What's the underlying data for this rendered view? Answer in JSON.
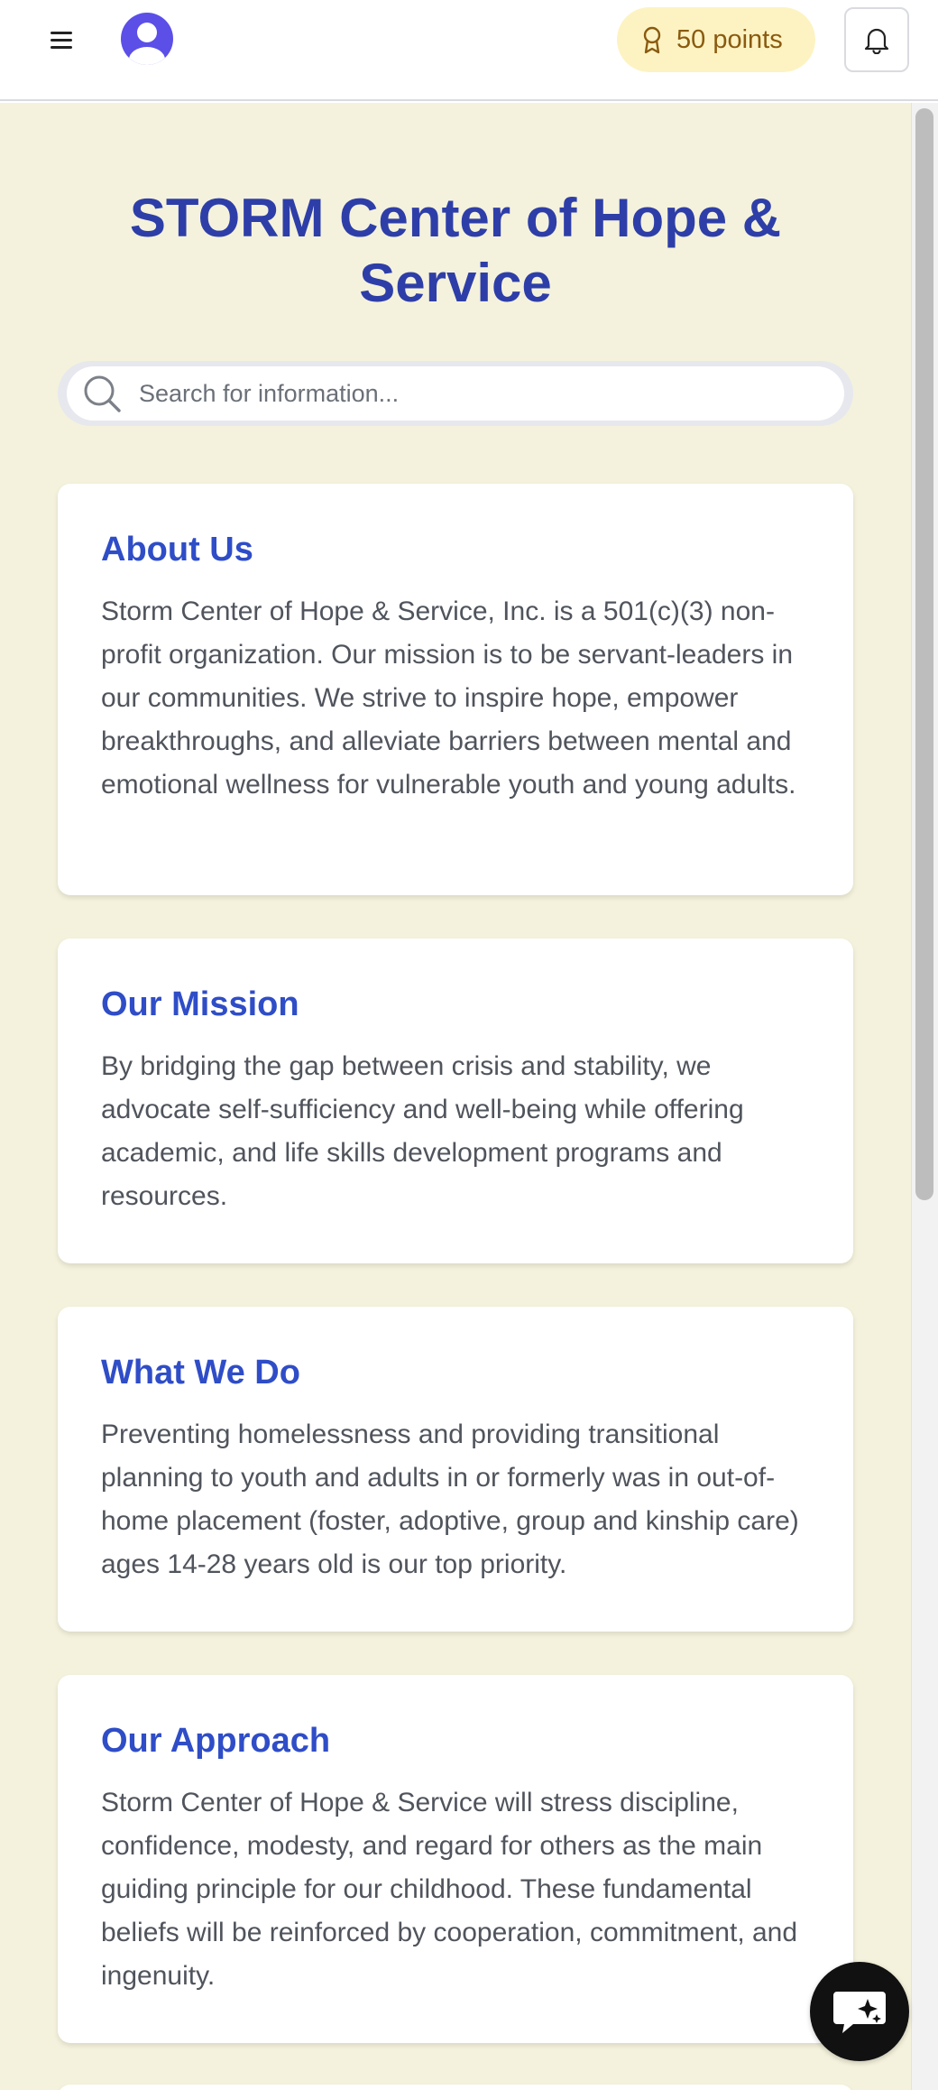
{
  "header": {
    "points_label": "50 points",
    "icons": {
      "menu": "hamburger-menu-icon",
      "avatar": "user-avatar-icon",
      "points": "award-ribbon-icon",
      "notifications": "bell-icon"
    }
  },
  "main": {
    "title": "STORM Center of Hope & Service",
    "search": {
      "placeholder": "Search for information...",
      "value": ""
    },
    "sections": [
      {
        "heading": "About Us",
        "body": "Storm Center of Hope & Service, Inc. is a 501(c)(3) non-profit organization. Our mission is to be servant-leaders in our communities. We strive to inspire hope, empower breakthroughs, and alleviate barriers between mental and emotional wellness for vulnerable youth and young adults."
      },
      {
        "heading": "Our Mission",
        "body": "By bridging the gap between crisis and stability, we advocate self-sufficiency and well-being while offering academic, and life skills development programs and resources."
      },
      {
        "heading": "What We Do",
        "body": "Preventing homelessness and providing transitional planning to youth and adults in or formerly was in out-of-home placement (foster, adoptive, group and kinship care) ages 14-28 years old is our top priority."
      },
      {
        "heading": "Our Approach",
        "body": "Storm Center of Hope & Service will stress discipline, confidence, modesty, and regard for others as the main guiding principle for our childhood. These fundamental beliefs will be reinforced by cooperation, commitment, and ingenuity."
      }
    ]
  },
  "colors": {
    "brand_title": "#2e3ea8",
    "section_heading": "#2f4dc7",
    "page_background": "#f4f2dc",
    "points_pill": "#fdf3c2",
    "points_text": "#8a5a10",
    "avatar": "#5b4fe8",
    "chat_button": "#111111"
  },
  "chat_button": {
    "icon": "chat-sparkle-icon"
  }
}
